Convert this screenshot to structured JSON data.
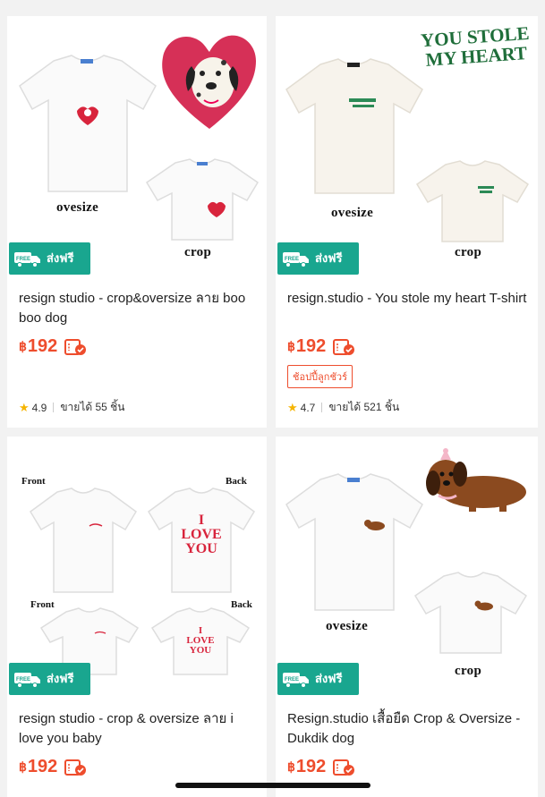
{
  "products": [
    {
      "title": "resign studio - crop&oversize ลาย boo boo dog",
      "image_labels": [
        "ovesize",
        "crop"
      ],
      "free_shipping": {
        "label": "ส่งฟรี",
        "tag": "FREE"
      },
      "currency": "฿",
      "price": "192",
      "rating": "4.9",
      "sold": "ขายได้ 55 ชิ้น"
    },
    {
      "title": "resign.studio - You stole my heart T-shirt",
      "image_banner": "YOU STOLE MY HEART",
      "image_labels": [
        "ovesize",
        "crop"
      ],
      "free_shipping": {
        "label": "ส่งฟรี",
        "tag": "FREE"
      },
      "currency": "฿",
      "price": "192",
      "badge": "ช้อปปี้ลูกชัวร์",
      "rating": "4.7",
      "sold": "ขายได้ 521 ชิ้น"
    },
    {
      "title": "resign studio - crop & oversize ลาย i love you baby",
      "image_labels": [
        "Front",
        "Back",
        "Front",
        "Back"
      ],
      "shirt_print": "I LOVE YOU",
      "free_shipping": {
        "label": "ส่งฟรี",
        "tag": "FREE"
      },
      "currency": "฿",
      "price": "192"
    },
    {
      "title": "Resign.studio เสื้อยืด Crop & Oversize - Dukdik dog",
      "image_labels": [
        "ovesize",
        "crop"
      ],
      "free_shipping": {
        "label": "ส่งฟรี",
        "tag": "FREE"
      },
      "currency": "฿",
      "price": "192"
    }
  ],
  "colors": {
    "price": "#ee4d2d",
    "free_shipping_bg": "#19a68f",
    "star": "#f5b400"
  },
  "icons": [
    "truck-icon",
    "voucher-icon",
    "star-icon",
    "heart-icon",
    "dog-icon"
  ]
}
